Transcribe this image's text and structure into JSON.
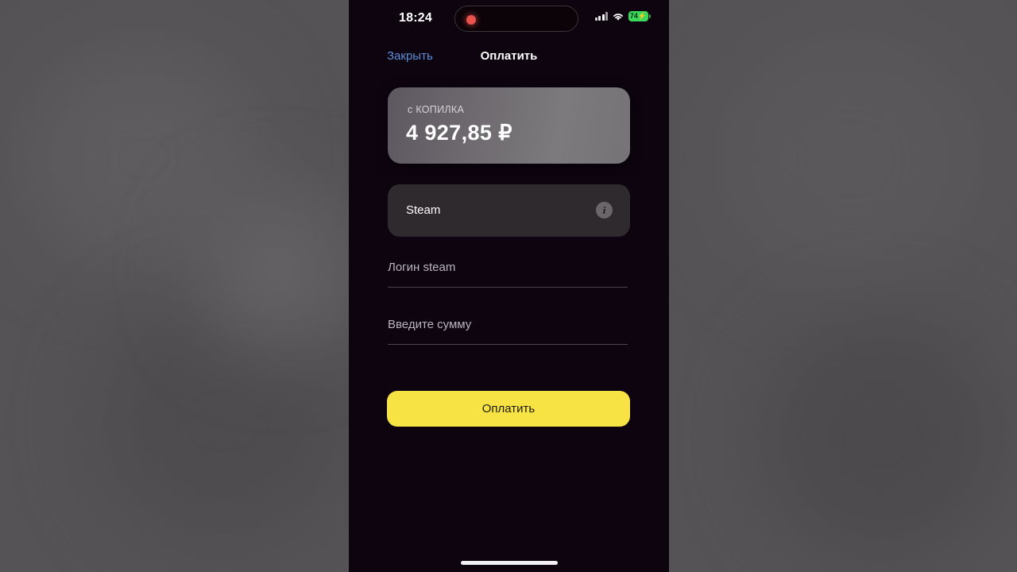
{
  "status_bar": {
    "time": "18:24",
    "recording_indicator": "recording-dot",
    "cellular_icon": "signal-bars-icon",
    "wifi_icon": "wifi-icon",
    "battery_level": "74",
    "battery_charging_glyph": "⚡",
    "battery_color": "#3ad95c"
  },
  "nav": {
    "close_label": "Закрыть",
    "title": "Оплатить",
    "close_color": "#5d8fd6"
  },
  "balance_card": {
    "source_label": "с КОПИЛКА",
    "amount": "4 927,85 ₽"
  },
  "service": {
    "name": "Steam",
    "info_glyph": "i"
  },
  "fields": [
    {
      "placeholder": "Логин steam",
      "value": ""
    },
    {
      "placeholder": "Введите сумму",
      "value": ""
    }
  ],
  "loading": {
    "spinner_label": "loading-spinner"
  },
  "pay_button": {
    "label": "Оплатить",
    "background": "#f7e344",
    "text_color": "#1d1a10"
  },
  "screen": {
    "background": "#0d0410"
  }
}
